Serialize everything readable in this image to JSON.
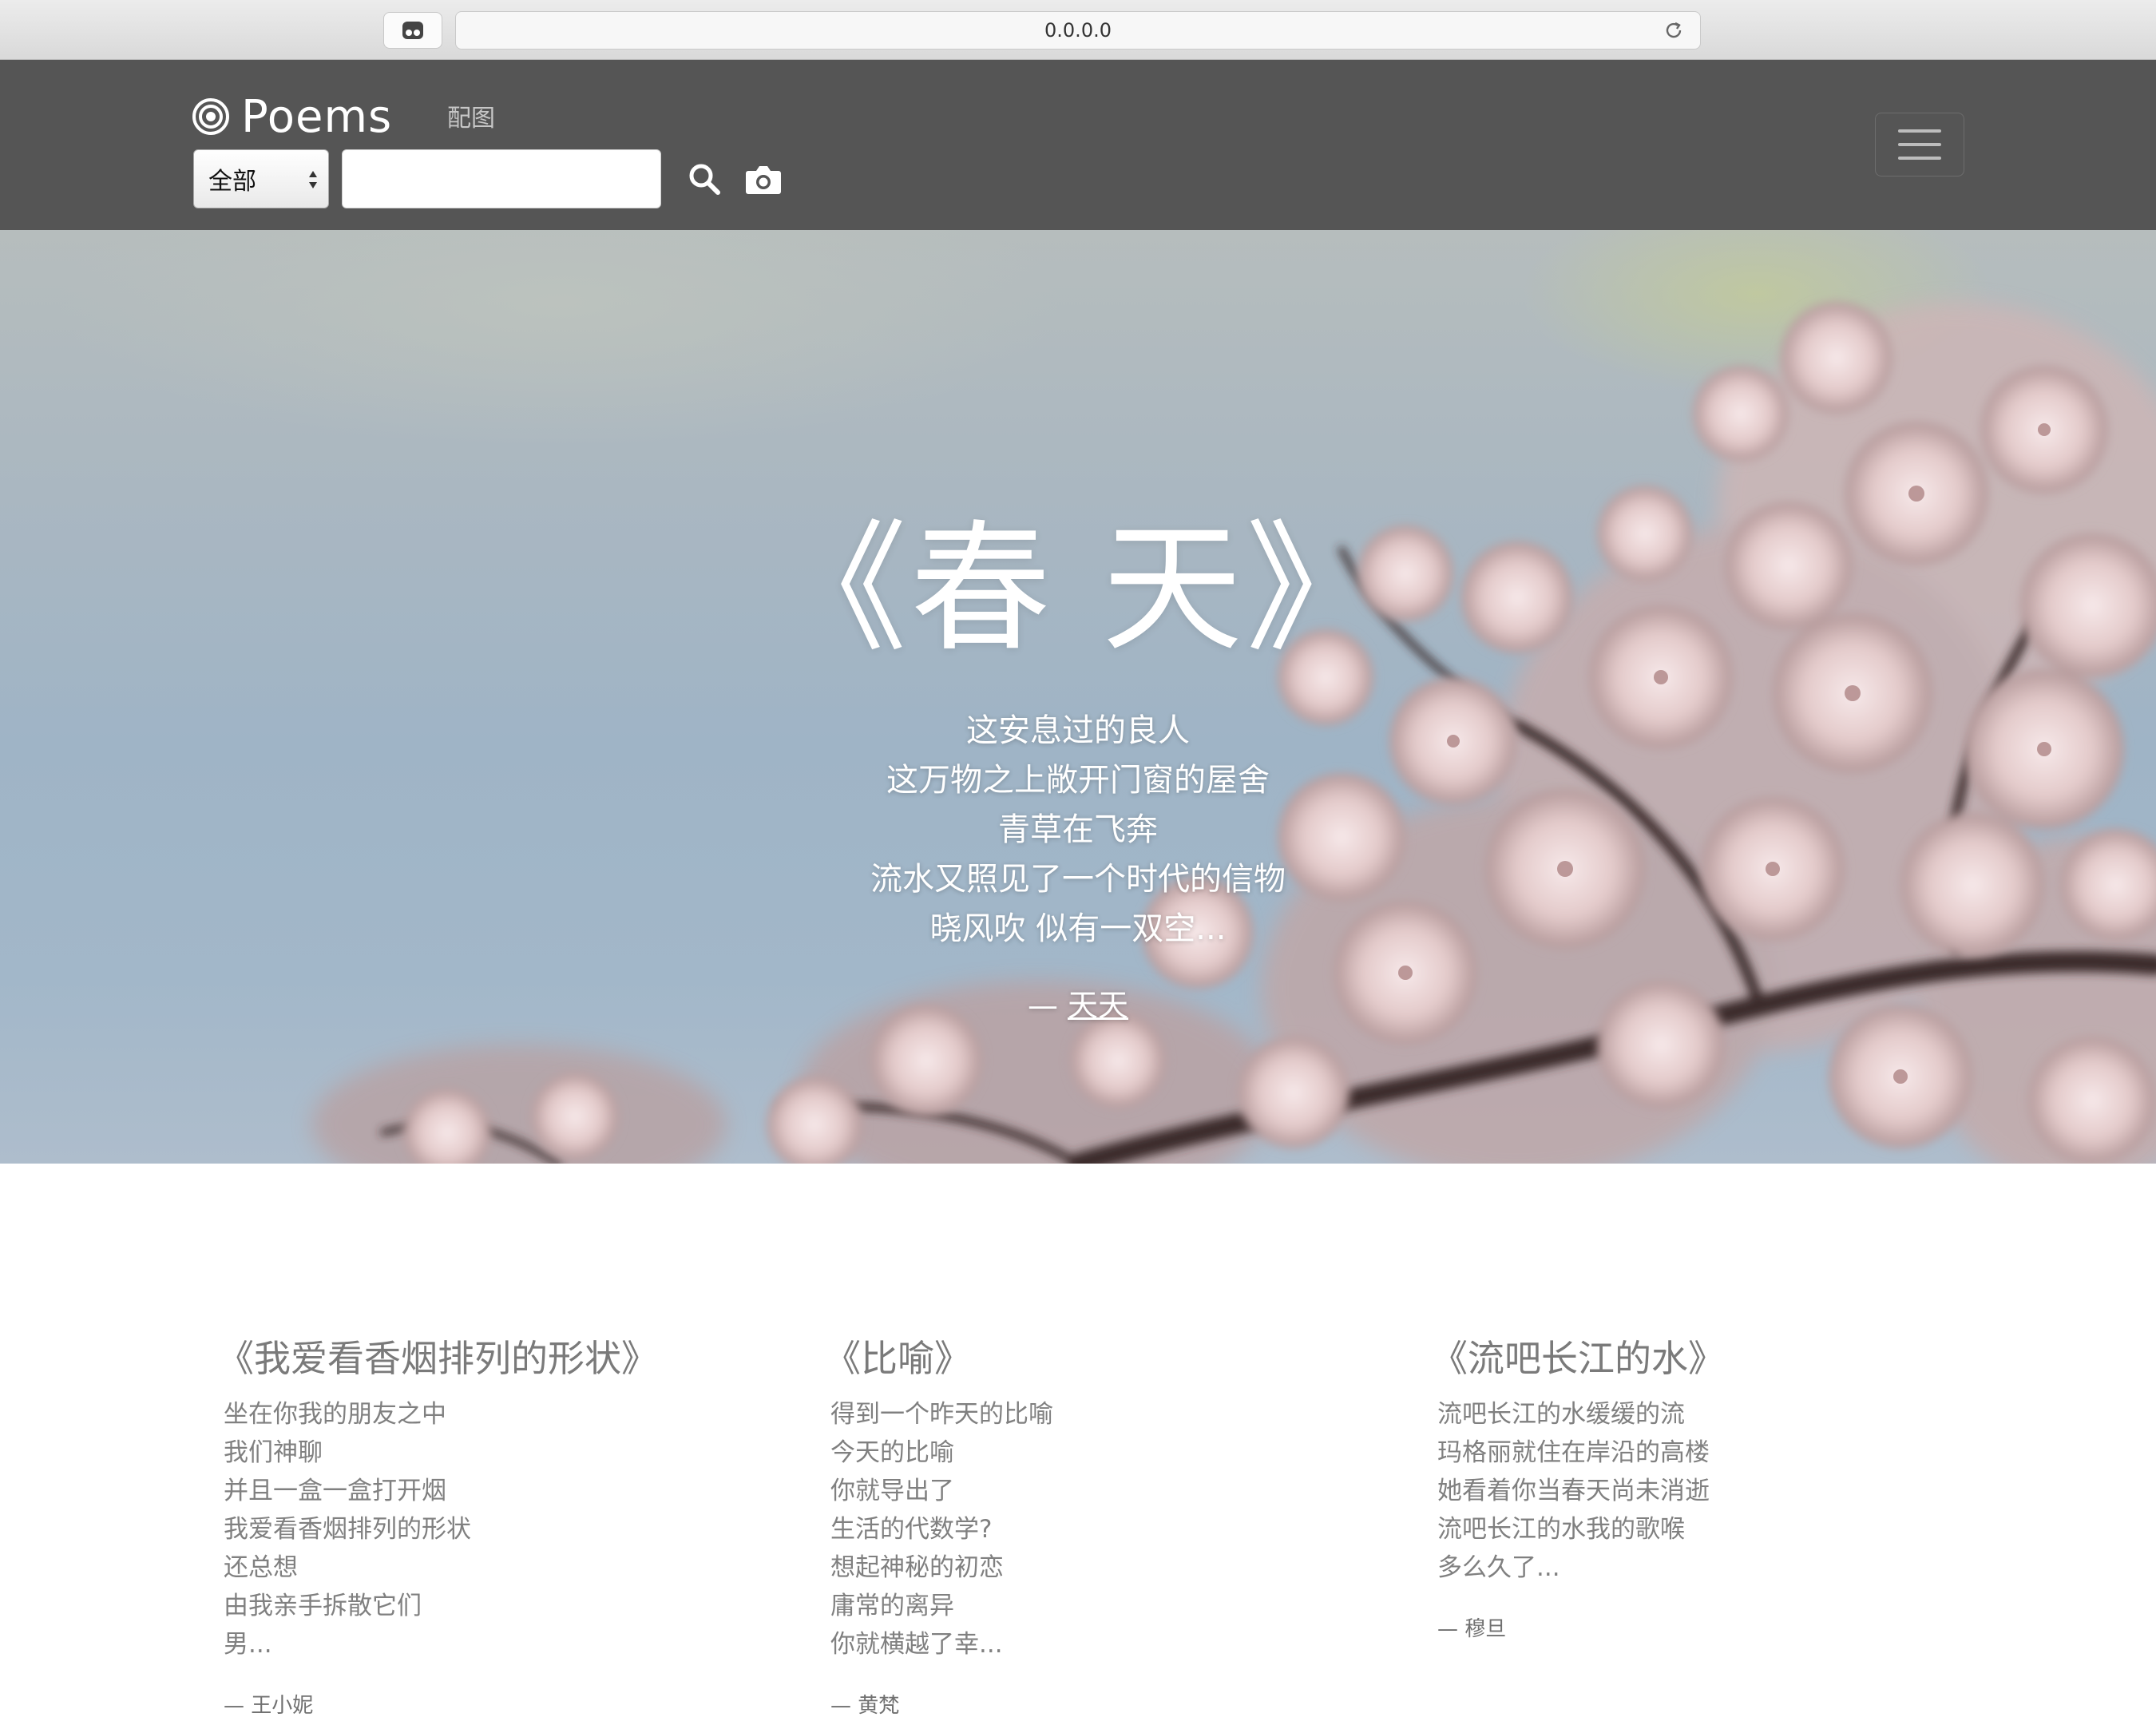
{
  "browser": {
    "url": "0.0.0.0"
  },
  "navbar": {
    "brand": "Poems",
    "link_label": "配图",
    "select_value": "全部",
    "search_value": ""
  },
  "hero": {
    "title": "《春 天》",
    "lines": [
      "这安息过的良人",
      "这万物之上敞开门窗的屋舍",
      "青草在飞奔",
      "流水又照见了一个时代的信物",
      "晓风吹 似有一双空..."
    ],
    "author_prefix": "— ",
    "author": "天天"
  },
  "poems": [
    {
      "title": "《我爱看香烟排列的形状》",
      "lines": [
        "坐在你我的朋友之中",
        "我们神聊",
        "并且一盒一盒打开烟",
        "我爱看香烟排列的形状",
        "还总想",
        "由我亲手拆散它们",
        "男..."
      ],
      "author": "— 王小妮"
    },
    {
      "title": "《比喻》",
      "lines": [
        "得到一个昨天的比喻",
        "今天的比喻",
        "你就导出了",
        "生活的代数学?",
        "想起神秘的初恋",
        "庸常的离异",
        "你就横越了幸..."
      ],
      "author": "— 黄梵"
    },
    {
      "title": "《流吧长江的水》",
      "lines": [
        "流吧长江的水缓缓的流",
        "玛格丽就住在岸沿的高楼",
        "她看着你当春天尚未消逝",
        "流吧长江的水我的歌喉",
        "多么久了..."
      ],
      "author": "— 穆旦"
    }
  ],
  "colors": {
    "navbar_bg": "#555555",
    "hero_sky": "#a2b7c9",
    "blossom": "#e6cfcf",
    "poem_text": "#808080"
  }
}
